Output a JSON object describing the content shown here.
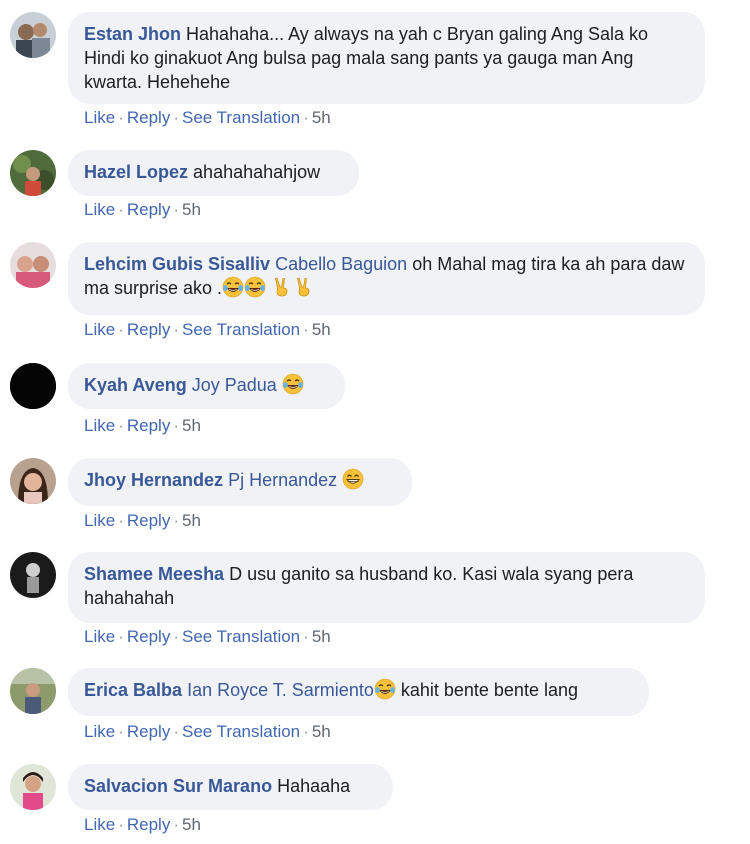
{
  "comments": [
    {
      "author": "Estan Jhon",
      "tag": "",
      "text": "Hahahaha... Ay always na yah c Bryan galing Ang Sala ko Hindi ko ginakuot Ang bulsa pag mala sang pants ya gauga man Ang kwarta. Hehehehe",
      "actions": {
        "like": "Like",
        "reply": "Reply",
        "translate": "See Translation",
        "time": "5h"
      },
      "avatar_icon": "profile-photo"
    },
    {
      "author": "Hazel Lopez",
      "tag": "",
      "text": "ahahahahahjow",
      "actions": {
        "like": "Like",
        "reply": "Reply",
        "time": "5h"
      },
      "avatar_icon": "profile-photo"
    },
    {
      "author": "Lehcim Gubis Sisalliv",
      "tag": "Cabello Baguion",
      "text": "oh Mahal mag tira ka ah para daw ma surprise ako .",
      "emoji": [
        "tears-of-joy",
        "tears-of-joy",
        "victory-hand",
        "victory-hand"
      ],
      "actions": {
        "like": "Like",
        "reply": "Reply",
        "translate": "See Translation",
        "time": "5h"
      },
      "avatar_icon": "profile-photo"
    },
    {
      "author": "Kyah Aveng",
      "tag": "Joy Padua",
      "text": "",
      "emoji": [
        "tears-of-joy"
      ],
      "actions": {
        "like": "Like",
        "reply": "Reply",
        "time": "5h"
      },
      "avatar_icon": "black-avatar"
    },
    {
      "author": "Jhoy Hernandez",
      "tag": "Pj Hernandez",
      "text": "",
      "emoji": [
        "grinning-face"
      ],
      "actions": {
        "like": "Like",
        "reply": "Reply",
        "time": "5h"
      },
      "avatar_icon": "profile-photo"
    },
    {
      "author": "Shamee Meesha",
      "tag": "",
      "text": "D usu ganito sa husband ko. Kasi wala syang pera hahahahah",
      "actions": {
        "like": "Like",
        "reply": "Reply",
        "translate": "See Translation",
        "time": "5h"
      },
      "avatar_icon": "profile-photo"
    },
    {
      "author": "Erica Balba",
      "tag": "Ian Royce T. Sarmiento",
      "text": " kahit bente bente lang",
      "emoji": [
        "tears-of-joy"
      ],
      "actions": {
        "like": "Like",
        "reply": "Reply",
        "translate": "See Translation",
        "time": "5h"
      },
      "avatar_icon": "profile-photo"
    },
    {
      "author": "Salvacion Sur Marano",
      "tag": "",
      "text": "Hahaaha",
      "actions": {
        "like": "Like",
        "reply": "Reply",
        "time": "5h"
      },
      "avatar_icon": "profile-photo"
    }
  ],
  "colors": {
    "author": "#385898",
    "action_link": "#4267b2",
    "bubble_bg": "#f0f2f5",
    "text": "#1c1e21"
  }
}
